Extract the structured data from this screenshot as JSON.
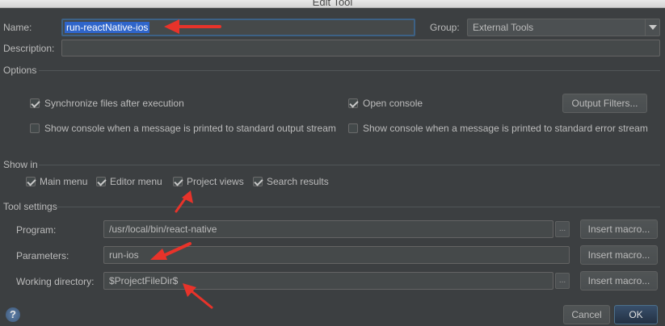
{
  "window": {
    "title": "Edit Tool"
  },
  "name": {
    "label": "Name:",
    "value": "run-reactNative-ios"
  },
  "group": {
    "label": "Group:",
    "value": "External Tools"
  },
  "description": {
    "label": "Description:",
    "value": ""
  },
  "options": {
    "title": "Options",
    "sync_files": {
      "label": "Synchronize files after execution",
      "checked": true
    },
    "open_console": {
      "label": "Open console",
      "checked": true
    },
    "output_filters": "Output Filters...",
    "show_console_stdout": {
      "label": "Show console when a message is printed to standard output stream",
      "checked": false
    },
    "show_console_stderr": {
      "label": "Show console when a message is printed to standard error stream",
      "checked": false
    }
  },
  "show_in": {
    "title": "Show in",
    "items": [
      {
        "label": "Main menu",
        "checked": true
      },
      {
        "label": "Editor menu",
        "checked": true
      },
      {
        "label": "Project views",
        "checked": true
      },
      {
        "label": "Search results",
        "checked": true
      }
    ]
  },
  "tool_settings": {
    "title": "Tool settings",
    "program": {
      "label": "Program:",
      "value": "/usr/local/bin/react-native"
    },
    "parameters": {
      "label": "Parameters:",
      "value": "run-ios"
    },
    "working_directory": {
      "label": "Working directory:",
      "value": "$ProjectFileDir$"
    },
    "browse_label": "...",
    "insert_macro": "Insert macro..."
  },
  "footer": {
    "help": "?",
    "cancel": "Cancel",
    "ok": "OK"
  },
  "colors": {
    "annotation_arrow": "#e8332a",
    "selection": "#2f65ca",
    "default_button": "#2f4a66"
  }
}
